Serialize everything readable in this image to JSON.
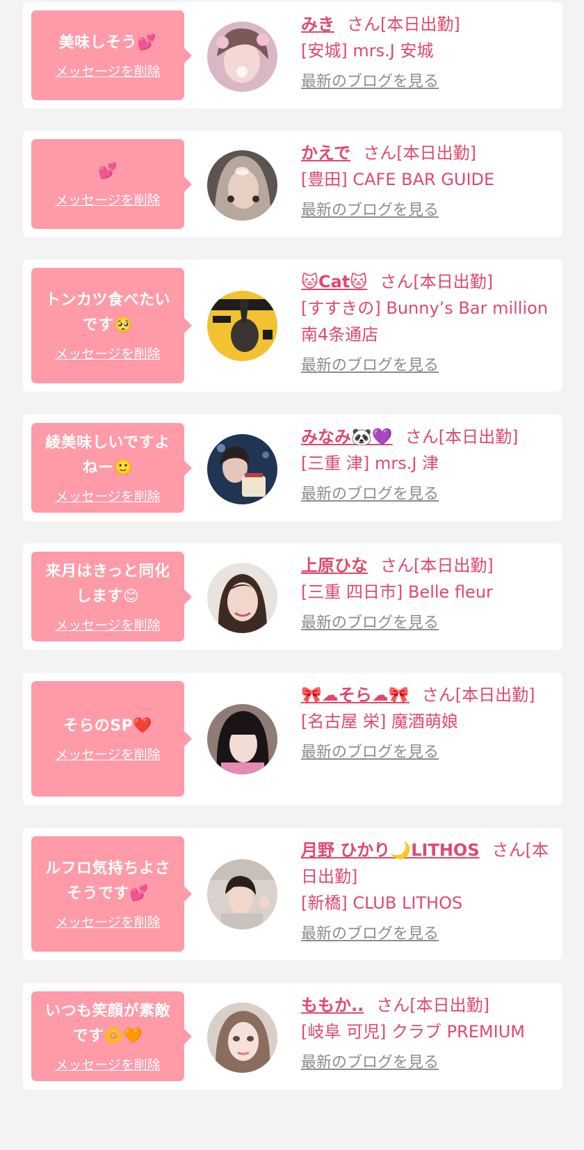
{
  "entries": [
    {
      "message": "美味しそう💕",
      "delete_label": "メッセージを削除",
      "name": "みき",
      "suffix": "さん[本日出勤]",
      "shop": "[安城] mrs.J 安城",
      "blog_label": "最新のブログを見る"
    },
    {
      "message": "💕",
      "delete_label": "メッセージを削除",
      "name": "かえで",
      "suffix": "さん[本日出勤]",
      "shop": "[豊田] CAFE BAR GUIDE",
      "blog_label": "最新のブログを見る"
    },
    {
      "message": "トンカツ食べたいです🥺",
      "delete_label": "メッセージを削除",
      "name": "🐱Cat🐱",
      "suffix": "さん[本日出勤]",
      "shop": "[すすきの] Bunny’s Bar million 南4条通店",
      "blog_label": "最新のブログを見る"
    },
    {
      "message": "綾美味しいですよねー🙂",
      "delete_label": "メッセージを削除",
      "name": "みなみ🐼💜",
      "suffix": "さん[本日出勤]",
      "shop": "[三重 津] mrs.J 津",
      "blog_label": "最新のブログを見る"
    },
    {
      "message": "来月はきっと同化します😊",
      "delete_label": "メッセージを削除",
      "name": "上原ひな",
      "suffix": "さん[本日出勤]",
      "shop": "[三重 四日市] Belle fleur",
      "blog_label": "最新のブログを見る"
    },
    {
      "message": "そらのSP❤️",
      "delete_label": "メッセージを削除",
      "name": "🎀☁そら☁🎀",
      "suffix": "さん[本日出勤]",
      "shop": "[名古屋 栄] 魔酒萌娘",
      "blog_label": "最新のブログを見る"
    },
    {
      "message": "ルフロ気持ちよさそうです💕",
      "delete_label": "メッセージを削除",
      "name": "月野 ひかり🌙LITHOS",
      "suffix": "さん[本日出勤]",
      "shop": "[新橋] CLUB LITHOS",
      "blog_label": "最新のブログを見る"
    },
    {
      "message": "いつも笑顔が素敵です🌼🧡",
      "delete_label": "メッセージを削除",
      "name": "ももか..",
      "suffix": "さん[本日出勤]",
      "shop": "[岐阜 可児] クラブ PREMIUM",
      "blog_label": "最新のブログを見る"
    }
  ],
  "colors": {
    "page_bg": "#f3f3f3",
    "bubble_bg": "#ff9aa8",
    "text_pink": "#e0486e",
    "blog_gray": "#8c8c8c"
  }
}
